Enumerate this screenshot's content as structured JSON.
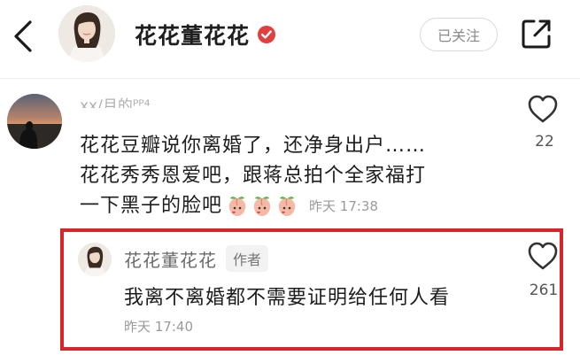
{
  "header": {
    "title": "花花董花花",
    "follow_label": "已关注",
    "icons": {
      "back": "chevron-left-icon",
      "verified": "verified-badge-icon",
      "share": "share-icon"
    },
    "verified_color": "#e2403f"
  },
  "comment": {
    "username_partial": "xx/月的ᴾᴾ⁴",
    "lines": [
      "花花豆瓣说你离婚了，还净身出户……",
      "花花秀秀恩爱吧，跟蒋总拍个全家福打",
      "一下黑子的脸吧"
    ],
    "emoji": [
      "peach-face-emoji",
      "peach-face-emoji",
      "peach-face-emoji"
    ],
    "time": "昨天 17:38",
    "like_count": "22"
  },
  "reply": {
    "username": "花花董花花",
    "author_badge": "作者",
    "text": "我离不离婚都不需要证明给任何人看",
    "time": "昨天 17:40",
    "like_count": "261",
    "highlight_color": "#d8252a"
  }
}
